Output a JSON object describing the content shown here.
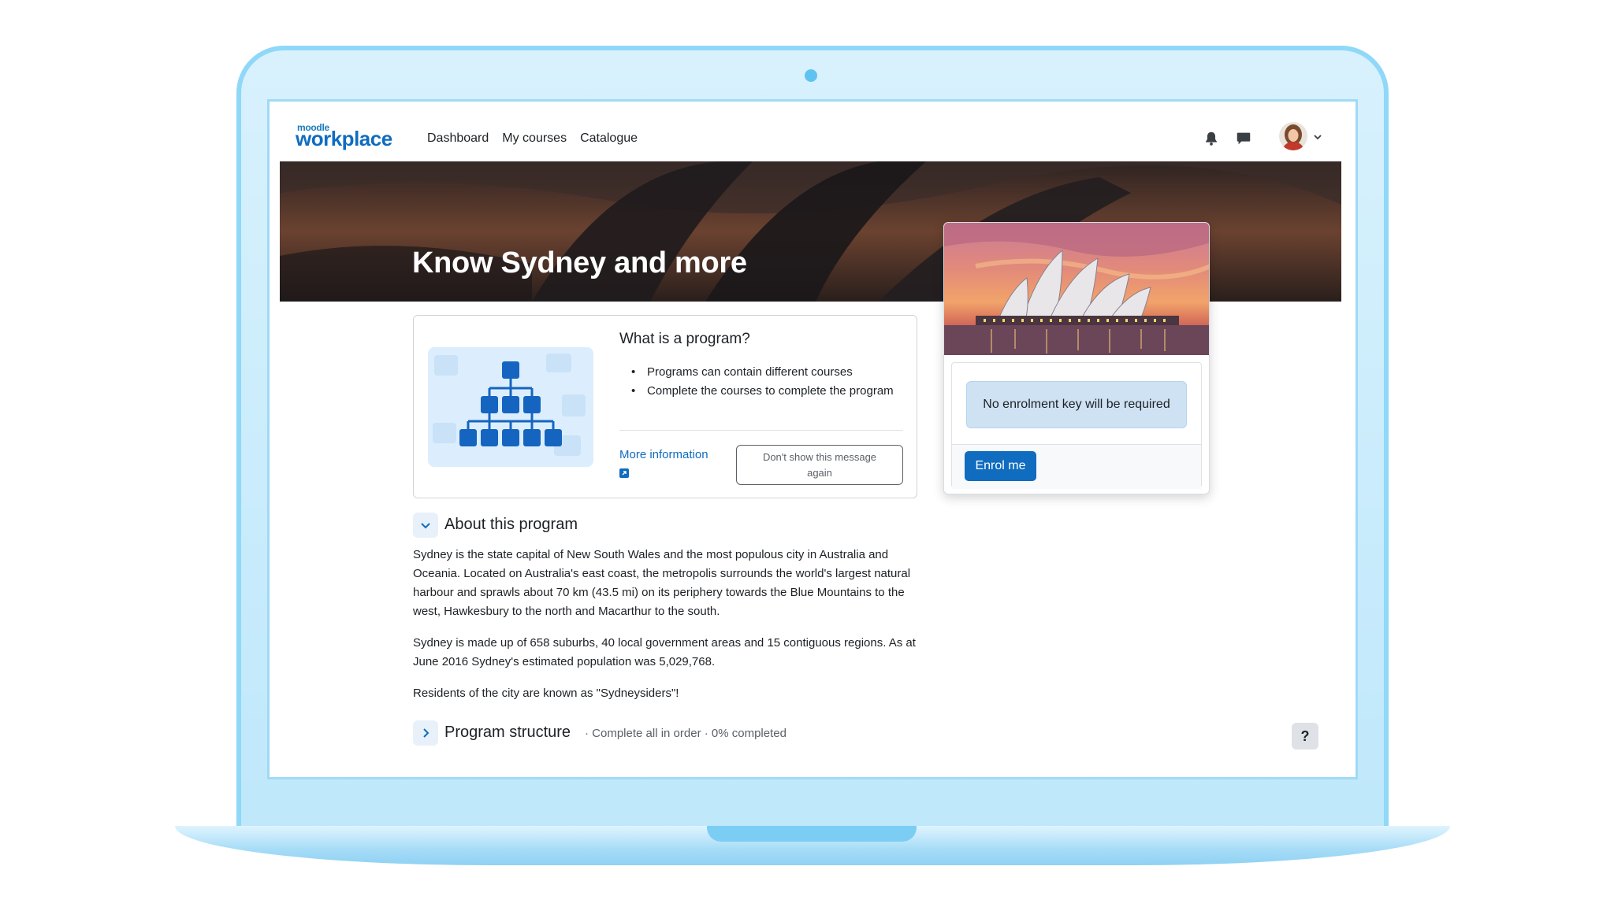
{
  "brand": {
    "logo_small": "moodle",
    "logo_big": "workplace",
    "accent_color": "#0f6cbf"
  },
  "nav": {
    "links": [
      "Dashboard",
      "My courses",
      "Catalogue"
    ],
    "icons": [
      "bell-icon",
      "chat-icon",
      "avatar",
      "chevron-down-icon"
    ]
  },
  "hero": {
    "title": "Know Sydney and more"
  },
  "info_card": {
    "title": "What is a program?",
    "bullets": [
      "Programs can contain different courses",
      "Complete the courses to complete the program"
    ],
    "more_link": "More information",
    "dismiss_button": "Don't show this message again"
  },
  "enrol": {
    "notice": "No enrolment key will be required",
    "button": "Enrol me"
  },
  "about": {
    "heading": "About this program",
    "paragraphs": [
      "Sydney is the state capital of New South Wales and the most populous city in Australia and Oceania. Located on Australia's east coast, the metropolis surrounds the world's largest natural harbour and sprawls about 70 km (43.5 mi) on its periphery towards the Blue Mountains to the west, Hawkesbury to the north and Macarthur to the south.",
      "Sydney is made up of 658 suburbs, 40 local government areas and 15 contiguous regions. As at June 2016 Sydney's estimated population was 5,029,768.",
      "Residents of the city are known as \"Sydneysiders\"!"
    ]
  },
  "program_structure": {
    "heading": "Program structure",
    "meta": "· Complete all in order · 0% completed"
  },
  "help": {
    "label": "?"
  }
}
